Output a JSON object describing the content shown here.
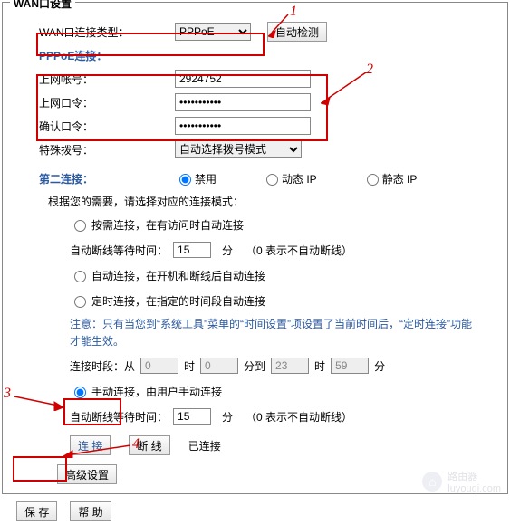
{
  "frame_title": "WAN口设置",
  "wan": {
    "conn_type_label": "WAN口连接类型：",
    "conn_type_value": "PPPoE",
    "auto_detect": "自动检测"
  },
  "pppoe": {
    "section_title": "PPPoE连接：",
    "account_label": "上网帐号：",
    "account_value": "2924752",
    "password_label": "上网口令：",
    "password_value": "•••••••••••",
    "confirm_label": "确认口令：",
    "confirm_value": "•••••••••••",
    "special_label": "特殊拨号：",
    "special_value": "自动选择拨号模式"
  },
  "second": {
    "label": "第二连接：",
    "disabled": "禁用",
    "dyn_ip": "动态 IP",
    "static_ip": "静态 IP"
  },
  "modes": {
    "intro": "根据您的需要，请选择对应的连接模式：",
    "on_demand": "按需连接，在有访问时自动连接",
    "on_demand_idle": "自动断线等待时间：",
    "on_demand_idle_val": "15",
    "idle_unit": "分",
    "idle_note": "（0 表示不自动断线）",
    "auto": "自动连接，在开机和断线后自动连接",
    "scheduled": "定时连接，在指定的时间段自动连接",
    "scheduled_note": "注意：只有当您到“系统工具”菜单的“时间设置”项设置了当前时间后，“定时连接”功能才能生效。",
    "period_label": "连接时段：从",
    "hour_unit": "时",
    "min_unit": "分",
    "to_label": "分到",
    "from_h": "0",
    "from_m": "0",
    "to_h": "23",
    "to_m": "59",
    "period_end": "分",
    "manual": "手动连接，由用户手动连接",
    "manual_idle": "自动断线等待时间：",
    "manual_idle_val": "15"
  },
  "conn": {
    "connect": "连 接",
    "disconnect": "断 线",
    "status": "已连接"
  },
  "adv": {
    "label": "高级设置"
  },
  "footer": {
    "save": "保 存",
    "help": "帮 助"
  },
  "callouts": {
    "c1": "1",
    "c2": "2",
    "c3": "3",
    "c4": "4"
  },
  "watermark": {
    "text": "路由器",
    "sub": "luyouqi.com"
  }
}
